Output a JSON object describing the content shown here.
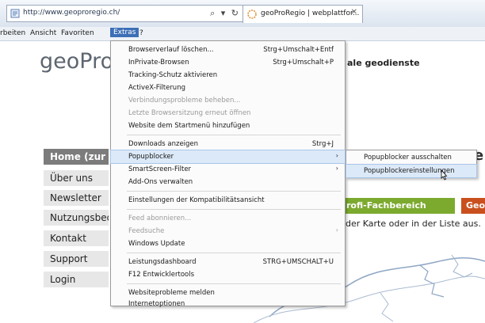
{
  "browser": {
    "url": "http://www.geoproregio.ch/",
    "address_tools": "⌕ ▾ ↻",
    "tab_title": "geoProRegio | webplattfor...",
    "tab_close": "✕"
  },
  "menubar": {
    "items": [
      "rbeiten",
      "Ansicht",
      "Favoriten",
      "Extras",
      "?"
    ]
  },
  "page": {
    "logo": "geoPro",
    "tagline": "ale geodienste",
    "nav": [
      "Home (zur K",
      "Über uns",
      "Newsletter",
      "Nutzungsbed",
      "Kontakt",
      "Support",
      "Login"
    ],
    "green_button": "rofi-Fachbereich",
    "orange_button": "Geo",
    "karte_text": "der Karte oder in der Liste aus.",
    "big_letter": "e"
  },
  "extras_menu": {
    "items": [
      {
        "label": "Browserverlauf löschen...",
        "shortcut": "Strg+Umschalt+Entf"
      },
      {
        "label": "InPrivate-Browsen",
        "shortcut": "Strg+Umschalt+P"
      },
      {
        "label": "Tracking-Schutz aktivieren",
        "shortcut": ""
      },
      {
        "label": "ActiveX-Filterung",
        "shortcut": ""
      },
      {
        "label": "Verbindungsprobleme beheben...",
        "shortcut": ""
      },
      {
        "label": "Letzte Browsersitzung erneut öffnen",
        "shortcut": ""
      },
      {
        "label": "Website dem Startmenü hinzufügen",
        "shortcut": ""
      },
      {
        "label": "Downloads anzeigen",
        "shortcut": "Strg+J"
      },
      {
        "label": "Popupblocker",
        "shortcut": ""
      },
      {
        "label": "SmartScreen-Filter",
        "shortcut": ""
      },
      {
        "label": "Add-Ons verwalten",
        "shortcut": ""
      },
      {
        "label": "Einstellungen der Kompatibilitätsansicht",
        "shortcut": ""
      },
      {
        "label": "Feed abonnieren...",
        "shortcut": ""
      },
      {
        "label": "Feedsuche",
        "shortcut": ""
      },
      {
        "label": "Windows Update",
        "shortcut": ""
      },
      {
        "label": "Leistungsdashboard",
        "shortcut": "STRG+UMSCHALT+U"
      },
      {
        "label": "F12 Entwicklertools",
        "shortcut": ""
      },
      {
        "label": "Websiteprobleme melden",
        "shortcut": ""
      },
      {
        "label": "Internetoptionen",
        "shortcut": ""
      }
    ],
    "submenu_arrow": "›"
  },
  "popup_submenu": {
    "items": [
      "Popupblocker ausschalten",
      "Popupblockereinstellungen"
    ]
  },
  "colors": {
    "menu_highlight": "#dce9f8",
    "nav_home": "#7c7c7c",
    "green": "#7caa2e",
    "orange": "#c9501e"
  }
}
